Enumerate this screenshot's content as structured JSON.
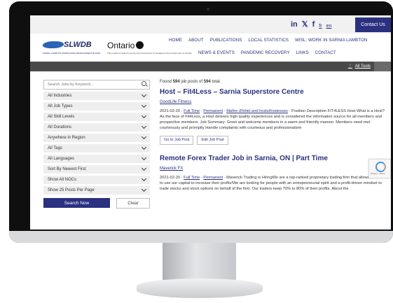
{
  "topbar": {
    "social": [
      "in",
      "🐦",
      "f"
    ],
    "lang_fr": "fr",
    "lang_en": "en",
    "contact_label": "Contact Us"
  },
  "logos": {
    "slwdb_name": "SLWDB",
    "slwdb_sub": "SARNIA LAMBTON WORKFORCE DEVELOPMENT BOARD",
    "ontario_name": "Ontario",
    "ontario_sub": "This project is funded in part by the Government of Canada and the Government of Ontario"
  },
  "nav": {
    "row1": [
      "HOME",
      "ABOUT",
      "PUBLICATIONS",
      "LOCAL STATISTICS",
      "WISL: WORK IN SARNIA LAMBTON"
    ],
    "row2": [
      "NEWS & EVENTS",
      "PANDEMIC RECOVERY",
      "LINKS",
      "CONTACT"
    ]
  },
  "tools": {
    "dots": "⋮",
    "label": "All Tools"
  },
  "sidebar": {
    "search_placeholder": "Search Jobs by Keyword...",
    "filters": [
      "All Industries",
      "All Job Types",
      "All Skill Levels",
      "All Durations",
      "Anywhere in Region",
      "All Tags",
      "All Languages",
      "Sort By Newest First",
      "Show All NOCs",
      "Show 25 Posts Per Page"
    ],
    "search_button": "Search Now",
    "clear_button": "Clear"
  },
  "results": {
    "found_prefix": "Found ",
    "found_count": "594",
    "found_mid": " job posts of ",
    "found_total": "594",
    "found_suffix": " total.",
    "jobs": [
      {
        "title": "Host – Fit4Less – Sarnia Superstore Centre",
        "company": "GoodLife Fitness",
        "date": "2021-02-20 · ",
        "tag1": "Full Time",
        "tag2": "Permanent",
        "tag3": "Maître d'hôtel and hosts/hostesses",
        "text": " · Position Description FIT4LESS Host What is a Host? As the face of Fit4Less, a Host delivers high quality experiences and is considered the information source for all members and prospective members. Job Summary: Greet and welcome members in a warm and friendly manner. Members need met courteously and promptly Handle complaints with courteous and professionalism",
        "btn1": "Go to Job Post",
        "btn2": "Edit Job Post"
      },
      {
        "title": "Remote Forex Trader Job in Sarnia, ON | Part Time",
        "company": "Maverick FX",
        "date": "2021-02-20 · ",
        "tag1": "Full Time",
        "tag2": "Permanent",
        "text": " · Maverick Trading is HiringWe are a top-ranked proprietary trading firm that allows traders to use our capital to increase their profits!We are looking for people with an entrepreneurial spirit and a profit-driven mindset to trade stocks and stock options on behalf of the firm. Our traders keep 70% to 80% of their profits. About the"
      }
    ]
  },
  "recaptcha": {
    "text": "Privacy - Terms"
  }
}
